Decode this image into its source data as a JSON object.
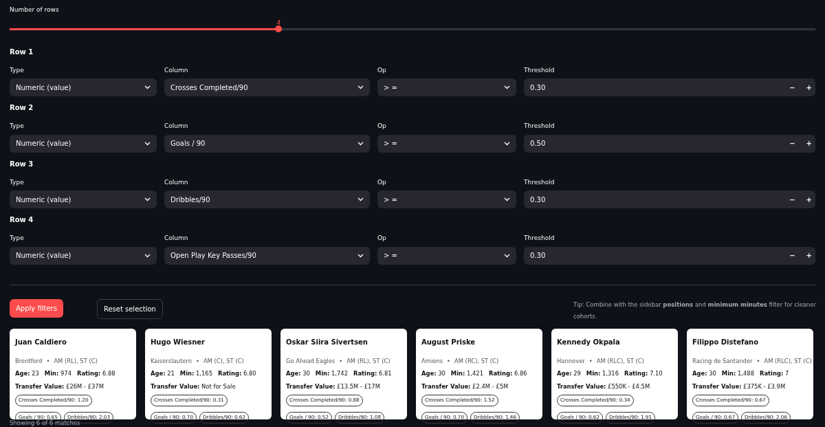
{
  "slider": {
    "label": "Number of rows",
    "value": "4",
    "level": 0.334
  },
  "filter_rows": [
    {
      "title": "Row 1",
      "type_label": "Type",
      "type": "Numeric (value)",
      "column_label": "Column",
      "column": "Crosses Completed/90",
      "op_label": "Op",
      "op": "> =",
      "threshold_label": "Threshold",
      "threshold": "0.30",
      "minus": "−",
      "plus": "+"
    },
    {
      "title": "Row 2",
      "type_label": "Type",
      "type": "Numeric (value)",
      "column_label": "Column",
      "column": "Goals / 90",
      "op_label": "Op",
      "op": "> =",
      "threshold_label": "Threshold",
      "threshold": "0.50",
      "minus": "−",
      "plus": "+"
    },
    {
      "title": "Row 3",
      "type_label": "Type",
      "type": "Numeric (value)",
      "column_label": "Column",
      "column": "Dribbles/90",
      "op_label": "Op",
      "op": "> =",
      "threshold_label": "Threshold",
      "threshold": "0.30",
      "minus": "−",
      "plus": "+"
    },
    {
      "title": "Row 4",
      "type_label": "Type",
      "type": "Numeric (value)",
      "column_label": "Column",
      "column": "Open Play Key Passes/90",
      "op_label": "Op",
      "op": "> =",
      "threshold_label": "Threshold",
      "threshold": "0.30",
      "minus": "−",
      "plus": "+"
    }
  ],
  "buttons": {
    "apply": "Apply filters",
    "reset": "Reset selection"
  },
  "tip": "Tip: Combine with the sidebar **positions** and **minimum minutes** filter for cleaner cohorts.",
  "separator": "•",
  "players": [
    {
      "name": "Juan Caldiero",
      "club": "Brentford",
      "positions": "AM (RL), ST (C)",
      "stats": "**Age:** 23   **Min:** 974   **Rating:** 6.88",
      "transfer": "**Transfer Value:** £26M - £37M",
      "chips": [
        "Crosses Completed/90: 1.20",
        "Goals / 90: 0.65",
        "Dribbles/90: 2.03"
      ]
    },
    {
      "name": "Hugo Wiesner",
      "club": "Kaiserslautern",
      "positions": "AM (C), ST (C)",
      "stats": "**Age:** 21   **Min:** 1,165   **Rating:** 6.80",
      "transfer": "**Transfer Value:** Not for Sale",
      "chips": [
        "Crosses Completed/90: 0.31",
        "Goals / 90: 0.70",
        "Dribbles/90: 0.62"
      ]
    },
    {
      "name": "Oskar Siira Sivertsen",
      "club": "Go Ahead Eagles",
      "positions": "AM (RL), ST (C)",
      "stats": "**Age:** 30   **Min:** 1,742   **Rating:** 6.81",
      "transfer": "**Transfer Value:** £13.5M - £17M",
      "chips": [
        "Crosses Completed/90: 0.88",
        "Goals / 90: 0.52",
        "Dribbles/90: 1.08"
      ]
    },
    {
      "name": "August Priske",
      "club": "Amiens",
      "positions": "AM (RC), ST (C)",
      "stats": "**Age:** 30   **Min:** 1,421   **Rating:** 6.86",
      "transfer": "**Transfer Value:** £2.4M - £5M",
      "chips": [
        "Crosses Completed/90: 1.52",
        "Goals / 90: 0.70",
        "Dribbles/90: 1.46"
      ]
    },
    {
      "name": "Kennedy Okpala",
      "club": "Hannover",
      "positions": "AM (RLC), ST (C)",
      "stats": "**Age:** 29   **Min:** 1,316   **Rating:** 7.10",
      "transfer": "**Transfer Value:** £550K - £4.5M",
      "chips": [
        "Crosses Completed/90: 0.34",
        "Goals / 90: 0.62",
        "Dribbles/90: 1.91"
      ]
    },
    {
      "name": "Filippo Distefano",
      "club": "Racing de Santander",
      "positions": "AM (RLC), ST (C)",
      "stats": "**Age:** 30   **Min:** 1,488   **Rating:** 7",
      "transfer": "**Transfer Value:** £375K - £3.9M",
      "chips": [
        "Crosses Completed/90: 0.67",
        "Goals / 90: 0.67",
        "Dribbles/90: 2.06"
      ]
    }
  ],
  "footer": "Showing 6 of 6 matches"
}
